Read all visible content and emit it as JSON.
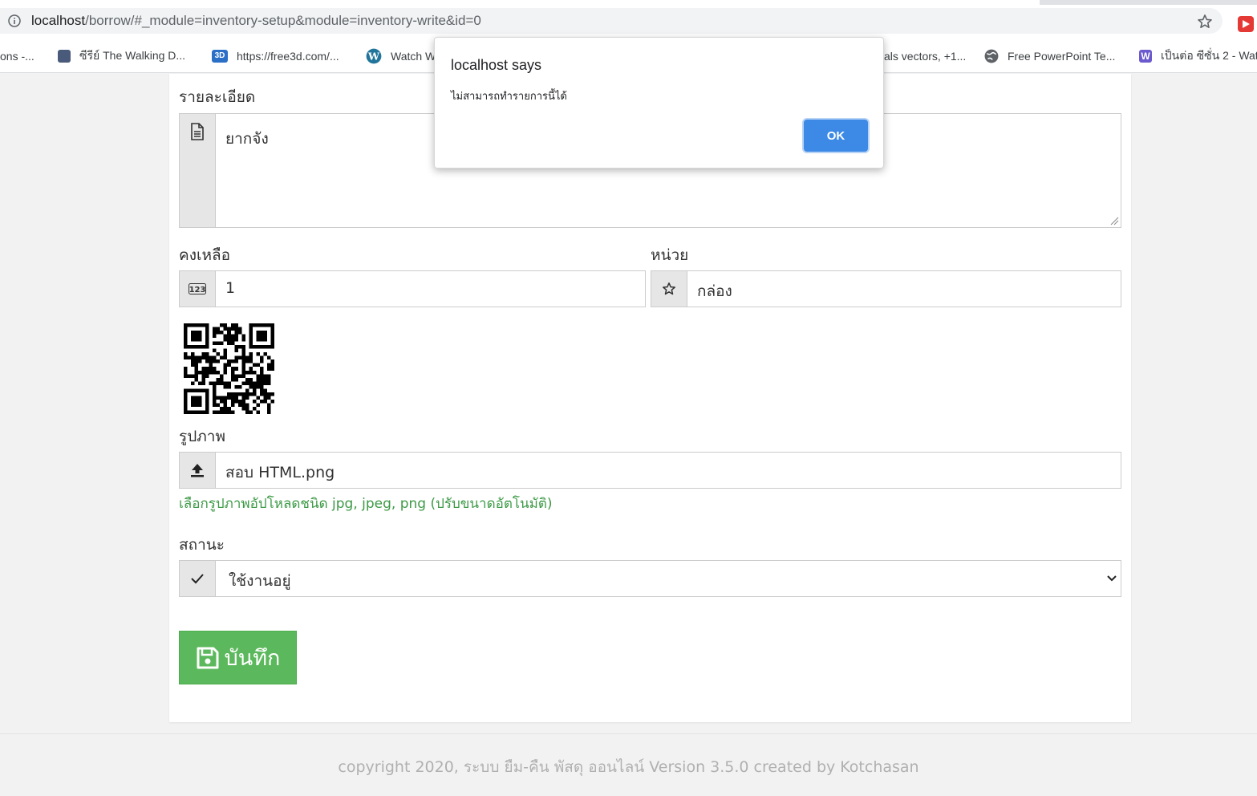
{
  "browser": {
    "url_host": "localhost",
    "url_path": "/borrow/#_module=inventory-setup&module=inventory-write&id=0",
    "bookmarks": [
      {
        "label": "ons -...",
        "icon": "none"
      },
      {
        "label": "ซีรีย์ The Walking D...",
        "icon": "film-icon"
      },
      {
        "label": "https://free3d.com/...",
        "icon": "free3d-icon"
      },
      {
        "label": "Watch W",
        "icon": "wordpress-icon"
      },
      {
        "label": "als vectors, +1...",
        "icon": "none"
      },
      {
        "label": "Free PowerPoint Te...",
        "icon": "globe-icon"
      },
      {
        "label": "เป็นต่อ ซีซั่น 2 - Wat",
        "icon": "w-icon"
      }
    ]
  },
  "form": {
    "detail_label": "รายละเอียด",
    "detail_value": "ยากจัง",
    "stock_label": "คงเหลือ",
    "stock_value": "1",
    "unit_label": "หน่วย",
    "unit_value": "กล่อง",
    "picture_label": "รูปภาพ",
    "picture_value": "สอบ HTML.png",
    "picture_help": "เลือกรูปภาพอัปโหลดชนิด jpg, jpeg, png (ปรับขนาดอัตโนมัติ)",
    "status_label": "สถานะ",
    "status_value": "ใช้งานอยู่",
    "save_label": "บันทึก"
  },
  "footer": {
    "text": "copyright 2020, ระบบ ยืม-คืน พัสดุ ออนไลน์ Version 3.5.0 created by Kotchasan"
  },
  "dialog": {
    "title": "localhost says",
    "message": "ไม่สามารถทำรายการนี้ได้",
    "ok_label": "OK"
  },
  "colors": {
    "save_button": "#5cb85c",
    "help_text": "#3c9a46",
    "dialog_ok": "#3c8ae6"
  }
}
